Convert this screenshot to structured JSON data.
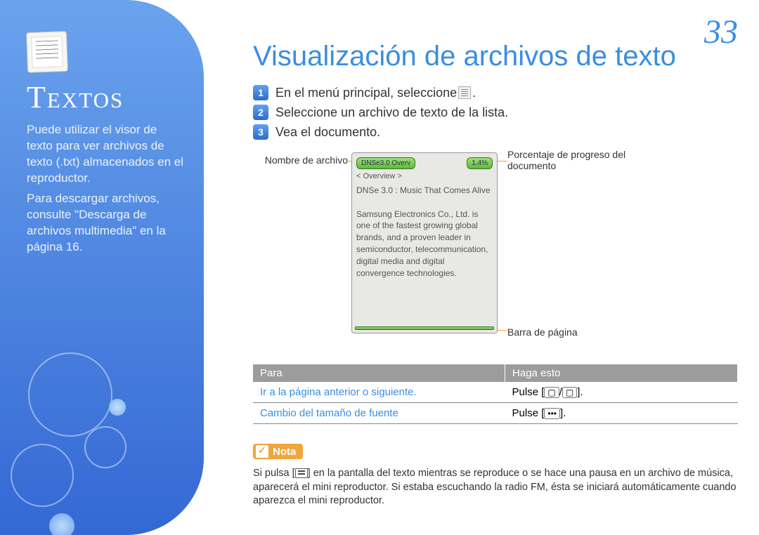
{
  "page_number": "33",
  "sidebar": {
    "title": "Textos",
    "para1": "Puede utilizar el visor de texto para ver archivos de texto (.txt) almacenados en el reproductor.",
    "para2": "Para descargar archivos, consulte \"Descarga de archivos multimedia\" en la página 16."
  },
  "main": {
    "title": "Visualización de archivos de texto",
    "steps": [
      "En el menú principal, seleccione ",
      "Seleccione un archivo de texto de la lista.",
      "Vea el documento."
    ],
    "step1_suffix": " ."
  },
  "diagram": {
    "filename_label": "Nombre de archivo",
    "progress_label": "Porcentaje de progreso del documento",
    "pagebar_label": "Barra de página",
    "device_filename": "DNSe3.0 Overv",
    "device_percent": "1.4%",
    "device_overview": "< Overview >",
    "device_body": "DNSe 3.0 : Music That Comes Alive\n\nSamsung Electronics Co., Ltd. is one of the fastest growing global brands, and a proven leader in semiconductor, telecommunication, digital media and digital convergence technologies."
  },
  "table": {
    "header_left": "Para",
    "header_right": "Haga esto",
    "rows": [
      {
        "left": "Ir a la página anterior o siguiente.",
        "right_prefix": "Pulse [",
        "right_suffix": "]."
      },
      {
        "left": "Cambio del tamaño de fuente",
        "right_prefix": "Pulse [",
        "mid": "•••",
        "right_suffix": "]."
      }
    ]
  },
  "note": {
    "label": "Nota",
    "text": "Si pulsa [≡] en la pantalla del texto mientras se reproduce o se hace una pausa en un archivo de música, aparecerá el mini reproductor. Si estaba escuchando la radio FM, ésta se iniciará automáticamente cuando aparezca el mini reproductor."
  }
}
